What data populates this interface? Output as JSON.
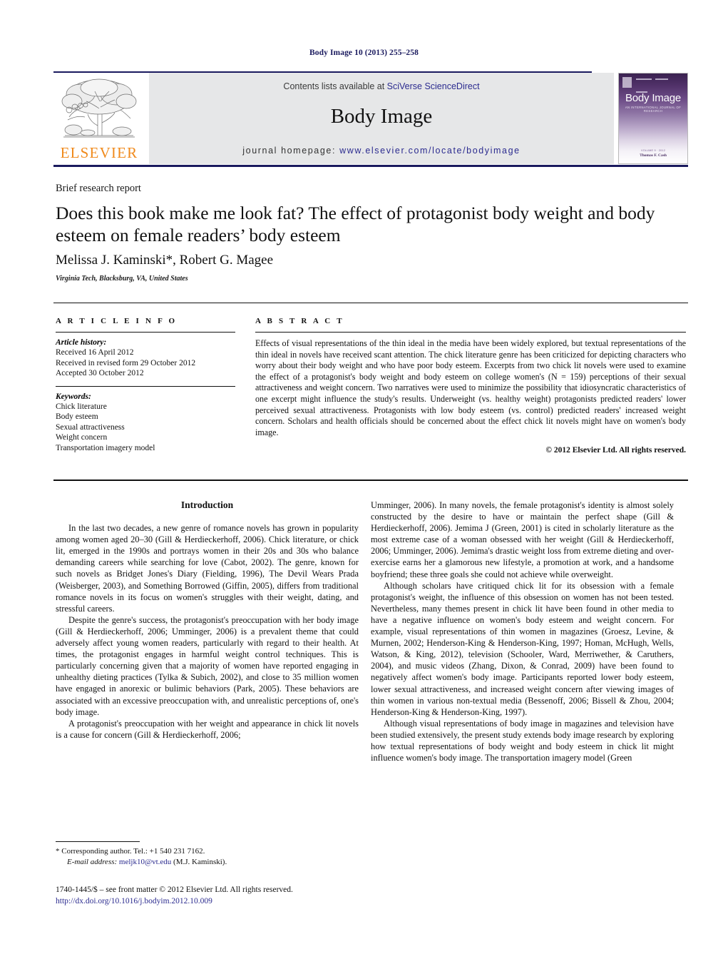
{
  "running_head": "Body Image 10 (2013) 255–258",
  "masthead": {
    "contents_prefix": "Contents lists available at ",
    "contents_link": "SciVerse ScienceDirect",
    "journal_title": "Body Image",
    "homepage_prefix": "journal homepage: ",
    "homepage_url": "www.elsevier.com/locate/bodyimage",
    "publisher_wordmark": "ELSEVIER",
    "cover": {
      "title": "Body Image",
      "subtitle": "AN INTERNATIONAL JOURNAL OF RESEARCH",
      "foot_small": "VOLUME 9 · 2012",
      "foot_bold": "Thomas F. Cash"
    }
  },
  "article": {
    "doctype": "Brief research report",
    "title": "Does this book make me look fat? The effect of protagonist body weight and body esteem on female readers’ body esteem",
    "authors": "Melissa J. Kaminski*, Robert G. Magee",
    "affiliation": "Virginia Tech, Blacksburg, VA, United States"
  },
  "info": {
    "heading": "A R T I C L E   I N F O",
    "history_label": "Article history:",
    "history": [
      "Received 16 April 2012",
      "Received in revised form 29 October 2012",
      "Accepted 30 October 2012"
    ],
    "keywords_label": "Keywords:",
    "keywords": [
      "Chick literature",
      "Body esteem",
      "Sexual attractiveness",
      "Weight concern",
      "Transportation imagery model"
    ]
  },
  "abstract": {
    "heading": "A B S T R A C T",
    "text": "Effects of visual representations of the thin ideal in the media have been widely explored, but textual representations of the thin ideal in novels have received scant attention. The chick literature genre has been criticized for depicting characters who worry about their body weight and who have poor body esteem. Excerpts from two chick lit novels were used to examine the effect of a protagonist's body weight and body esteem on college women's (N = 159) perceptions of their sexual attractiveness and weight concern. Two narratives were used to minimize the possibility that idiosyncratic characteristics of one excerpt might influence the study's results. Underweight (vs. healthy weight) protagonists predicted readers' lower perceived sexual attractiveness. Protagonists with low body esteem (vs. control) predicted readers' increased weight concern. Scholars and health officials should be concerned about the effect chick lit novels might have on women's body image.",
    "copyright": "© 2012 Elsevier Ltd. All rights reserved."
  },
  "body": {
    "section_title": "Introduction",
    "left_paragraphs": [
      "In the last two decades, a new genre of romance novels has grown in popularity among women aged 20–30 (Gill & Herdieckerhoff, 2006). Chick literature, or chick lit, emerged in the 1990s and portrays women in their 20s and 30s who balance demanding careers while searching for love (Cabot, 2002). The genre, known for such novels as Bridget Jones's Diary (Fielding, 1996), The Devil Wears Prada (Weisberger, 2003), and Something Borrowed (Giffin, 2005), differs from traditional romance novels in its focus on women's struggles with their weight, dating, and stressful careers.",
      "Despite the genre's success, the protagonist's preoccupation with her body image (Gill & Herdieckerhoff, 2006; Umminger, 2006) is a prevalent theme that could adversely affect young women readers, particularly with regard to their health. At times, the protagonist engages in harmful weight control techniques. This is particularly concerning given that a majority of women have reported engaging in unhealthy dieting practices (Tylka & Subich, 2002), and close to 35 million women have engaged in anorexic or bulimic behaviors (Park, 2005). These behaviors are associated with an excessive preoccupation with, and unrealistic perceptions of, one's body image.",
      "A protagonist's preoccupation with her weight and appearance in chick lit novels is a cause for concern (Gill & Herdieckerhoff, 2006;"
    ],
    "right_paragraphs": [
      "Umminger, 2006). In many novels, the female protagonist's identity is almost solely constructed by the desire to have or maintain the perfect shape (Gill & Herdieckerhoff, 2006). Jemima J (Green, 2001) is cited in scholarly literature as the most extreme case of a woman obsessed with her weight (Gill & Herdieckerhoff, 2006; Umminger, 2006). Jemima's drastic weight loss from extreme dieting and over-exercise earns her a glamorous new lifestyle, a promotion at work, and a handsome boyfriend; these three goals she could not achieve while overweight.",
      "Although scholars have critiqued chick lit for its obsession with a female protagonist's weight, the influence of this obsession on women has not been tested. Nevertheless, many themes present in chick lit have been found in other media to have a negative influence on women's body esteem and weight concern. For example, visual representations of thin women in magazines (Groesz, Levine, & Murnen, 2002; Henderson-King & Henderson-King, 1997; Homan, McHugh, Wells, Watson, & King, 2012), television (Schooler, Ward, Merriwether, & Caruthers, 2004), and music videos (Zhang, Dixon, & Conrad, 2009) have been found to negatively affect women's body image. Participants reported lower body esteem, lower sexual attractiveness, and increased weight concern after viewing images of thin women in various non-textual media (Bessenoff, 2006; Bissell & Zhou, 2004; Henderson-King & Henderson-King, 1997).",
      "Although visual representations of body image in magazines and television have been studied extensively, the present study extends body image research by exploring how textual representations of body weight and body esteem in chick lit might influence women's body image. The transportation imagery model (Green"
    ]
  },
  "footnote": {
    "corresponding": "* Corresponding author. Tel.: +1 540 231 7162.",
    "email_label": "E-mail address:",
    "email": "meljk10@vt.edu",
    "email_suffix": "(M.J. Kaminski)."
  },
  "footer": {
    "front_matter": "1740-1445/$ – see front matter © 2012 Elsevier Ltd. All rights reserved.",
    "doi": "http://dx.doi.org/10.1016/j.bodyim.2012.10.009"
  },
  "colors": {
    "link_blue": "#2b2b8f",
    "header_navy": "#1a1a5e",
    "elsevier_orange": "#f08a1c",
    "panel_grey": "#e6e7e8",
    "cover_purple": "#3a2250"
  }
}
